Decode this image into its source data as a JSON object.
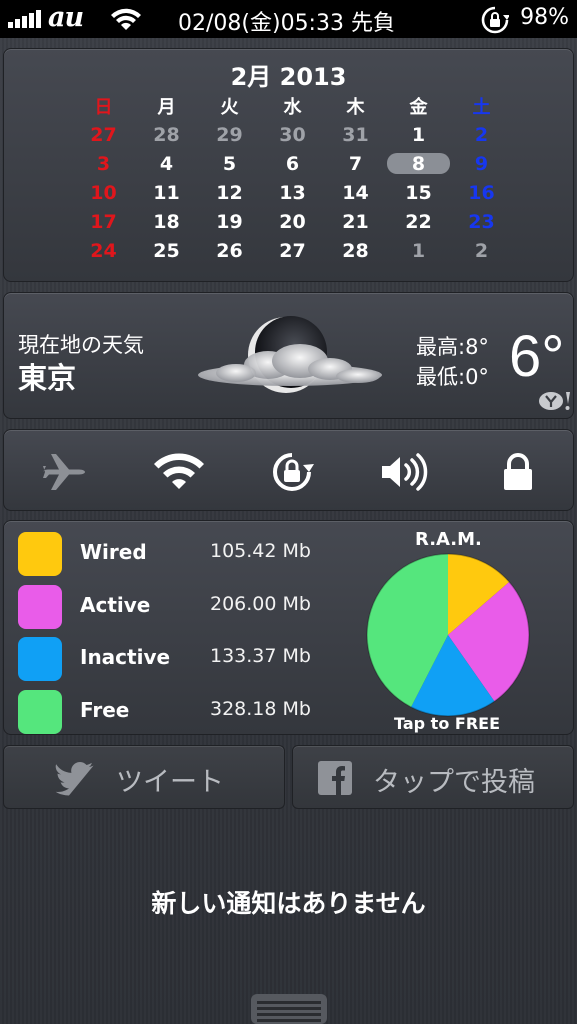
{
  "status_bar": {
    "carrier": "au",
    "time": "02/08(金)05:33 先負",
    "battery": "98%"
  },
  "calendar": {
    "title": "2月 2013",
    "weekdays": [
      "日",
      "月",
      "火",
      "水",
      "木",
      "金",
      "土"
    ],
    "weeks": [
      [
        "27",
        "28",
        "29",
        "30",
        "31",
        "1",
        "2"
      ],
      [
        "3",
        "4",
        "5",
        "6",
        "7",
        "8",
        "9"
      ],
      [
        "10",
        "11",
        "12",
        "13",
        "14",
        "15",
        "16"
      ],
      [
        "17",
        "18",
        "19",
        "20",
        "21",
        "22",
        "23"
      ],
      [
        "24",
        "25",
        "26",
        "27",
        "28",
        "1",
        "2"
      ]
    ],
    "today": "8"
  },
  "weather": {
    "label": "現在地の天気",
    "city": "東京",
    "high": "最高:8°",
    "low": "最低:0°",
    "temp": "6°"
  },
  "toggles": [
    {
      "name": "airplane-mode-icon",
      "enabled": false
    },
    {
      "name": "wifi-icon",
      "enabled": true
    },
    {
      "name": "rotation-lock-icon",
      "enabled": true
    },
    {
      "name": "sound-icon",
      "enabled": true
    },
    {
      "name": "lock-icon",
      "enabled": true
    }
  ],
  "ram": {
    "title": "R.A.M.",
    "tap_label": "Tap to FREE",
    "items": [
      {
        "name": "Wired",
        "value": "105.42 Mb",
        "color": "#ffc90e"
      },
      {
        "name": "Active",
        "value": "206.00 Mb",
        "color": "#e95ce9"
      },
      {
        "name": "Inactive",
        "value": "133.37 Mb",
        "color": "#10a0f5"
      },
      {
        "name": "Free",
        "value": "328.18 Mb",
        "color": "#55e67d"
      }
    ]
  },
  "share": {
    "tweet": "ツイート",
    "facebook": "タップで投稿"
  },
  "notifications": {
    "empty": "新しい通知はありません"
  }
}
